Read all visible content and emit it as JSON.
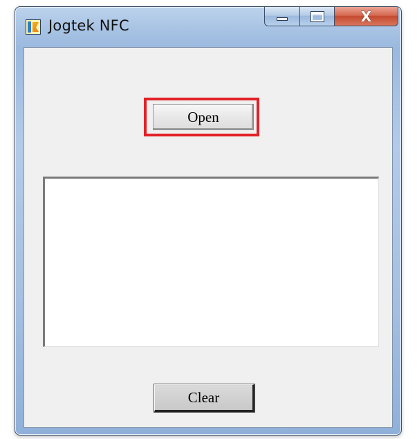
{
  "window": {
    "title": "Jogtek NFC",
    "icon": "jogtek-app-icon",
    "caption": {
      "minimize_icon": "minimize-icon",
      "maximize_icon": "maximize-icon",
      "close_glyph": "X"
    }
  },
  "main": {
    "open_label": "Open",
    "clear_label": "Clear",
    "output_text": ""
  },
  "colors": {
    "highlight": "#e12127",
    "client_bg": "#f0f0f0",
    "frame": "#a9c4e4"
  }
}
